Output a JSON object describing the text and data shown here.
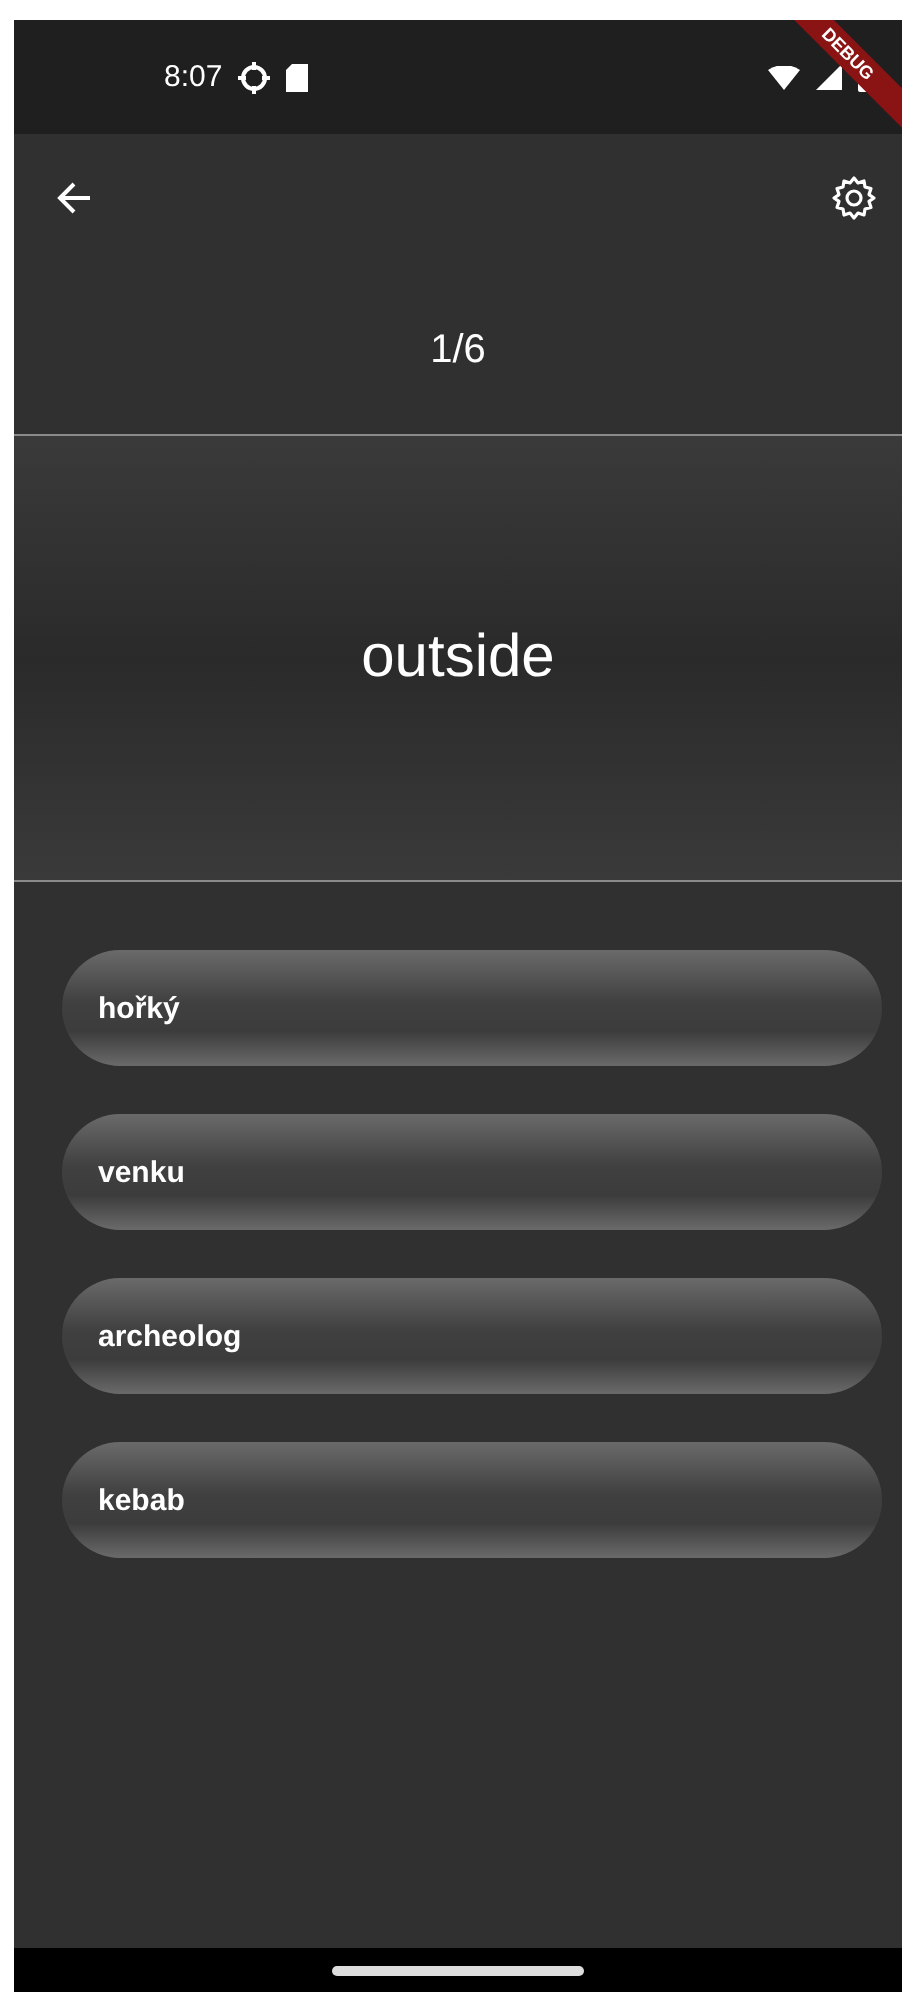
{
  "status_bar": {
    "time": "8:07"
  },
  "debug_banner": "DEBUG",
  "progress": "1/6",
  "prompt_word": "outside",
  "answers": [
    {
      "label": "hořký"
    },
    {
      "label": "venku"
    },
    {
      "label": "archeolog"
    },
    {
      "label": "kebab"
    }
  ]
}
